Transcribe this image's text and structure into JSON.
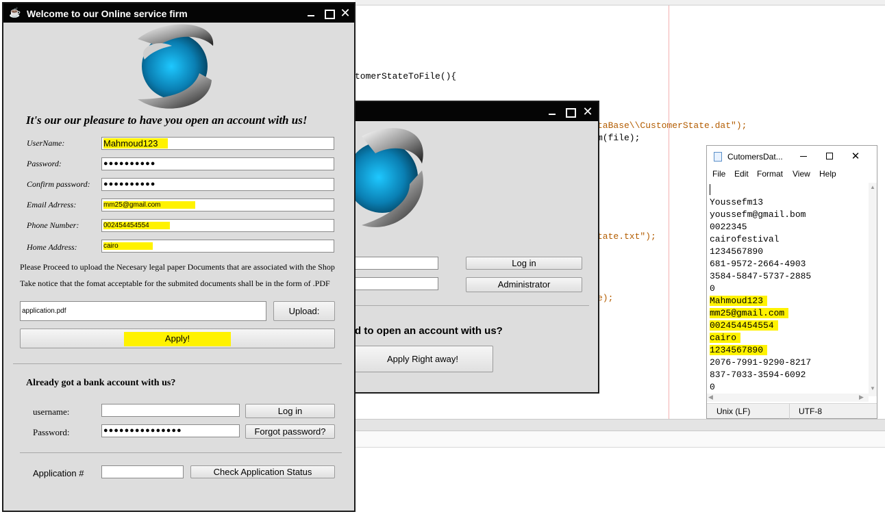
{
  "ide": {
    "code_lines": [
      {
        "text": "tomerStateToFile(){",
        "kind": "code"
      },
      {
        "text": "taBase\\\\CustomerState.dat\");",
        "kind": "str"
      },
      {
        "text": "m(file);",
        "kind": "code"
      },
      {
        "text": "tate.txt\");",
        "kind": "str"
      },
      {
        "text": "e);",
        "kind": "str"
      }
    ]
  },
  "main_window": {
    "title": "Welcome to our Online service firm",
    "heading": "It's our our pleasure to have you open an account with us!",
    "fields": [
      {
        "label": "UserName:",
        "value": "Mahmoud123"
      },
      {
        "label": "Password:",
        "value": "●●●●●●●●●●"
      },
      {
        "label": "Confirm password:",
        "value": "●●●●●●●●●●"
      },
      {
        "label": "Email Adrress:",
        "value": "mm25@gmail.com"
      },
      {
        "label": "Phone Number:",
        "value": "002454454554"
      },
      {
        "label": "Home Address:",
        "value": "cairo"
      }
    ],
    "notice1": "Please Proceed to upload the Necesary legal paper Documents that are associated with the Shop",
    "notice2": "Take notice that the  fomat acceptable for the submited documents shall be in the form of .PDF",
    "file_value": "application.pdf",
    "upload_label": "Upload:",
    "apply_label": "Apply!",
    "already_heading": "Already got a bank account with us?",
    "username_label": "username:",
    "username_value": "",
    "password_label": "Password:",
    "password_value": "●●●●●●●●●●●●●●●",
    "login_label": "Log in",
    "forgot_label": "Forgot password?",
    "appnum_label": "Application #",
    "appnum_value": "",
    "check_label": "Check Application Status"
  },
  "second_window": {
    "login_label": "Log in",
    "admin_label": "Administrator",
    "heading": "d to open an account with us?",
    "apply_label": "Apply Right away!"
  },
  "notepad": {
    "title": "CutomersDat...",
    "menu": [
      "File",
      "Edit",
      "Format",
      "View",
      "Help"
    ],
    "lines": [
      {
        "text": "",
        "hl": false
      },
      {
        "text": "Youssefm13",
        "hl": false
      },
      {
        "text": "youssefm@gmail.bom",
        "hl": false
      },
      {
        "text": "0022345",
        "hl": false
      },
      {
        "text": "cairofestival",
        "hl": false
      },
      {
        "text": "1234567890",
        "hl": false
      },
      {
        "text": "681-9572-2664-4903",
        "hl": false
      },
      {
        "text": "3584-5847-5737-2885",
        "hl": false
      },
      {
        "text": "0",
        "hl": false
      },
      {
        "text": "Mahmoud123",
        "hl": true
      },
      {
        "text": "mm25@gmail.com",
        "hl": true
      },
      {
        "text": "002454454554",
        "hl": true
      },
      {
        "text": "cairo",
        "hl": true
      },
      {
        "text": "1234567890",
        "hl": true
      },
      {
        "text": "2076-7991-9290-8217",
        "hl": false
      },
      {
        "text": "837-7033-3594-6092",
        "hl": false
      },
      {
        "text": "0",
        "hl": false
      }
    ],
    "status_eol": "Unix (LF)",
    "status_enc": "UTF-8"
  },
  "colors": {
    "highlight": "#fff200",
    "titlebar": "#050505",
    "window_bg": "#dddddd"
  }
}
